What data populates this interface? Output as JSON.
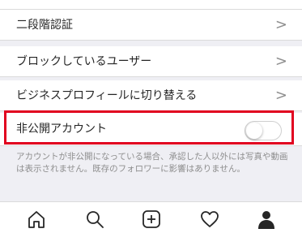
{
  "settings": {
    "two_factor": "二段階認証",
    "blocked_users": "ブロックしているユーザー",
    "switch_business": "ビジネスプロフィールに切り替える",
    "private_account": "非公開アカウント",
    "private_account_enabled": false,
    "private_note": "アカウントが非公開になっている場合、承認した人以外には写真や動画は表示されません。既存のフォロワーに影響はありません。"
  },
  "tabbar": {
    "items": [
      "home-icon",
      "search-icon",
      "add-icon",
      "heart-icon",
      "profile-icon"
    ],
    "active": "profile-icon"
  },
  "colors": {
    "highlight": "#e1001f",
    "separator": "#dbdbdb",
    "background": "#efeff4"
  }
}
